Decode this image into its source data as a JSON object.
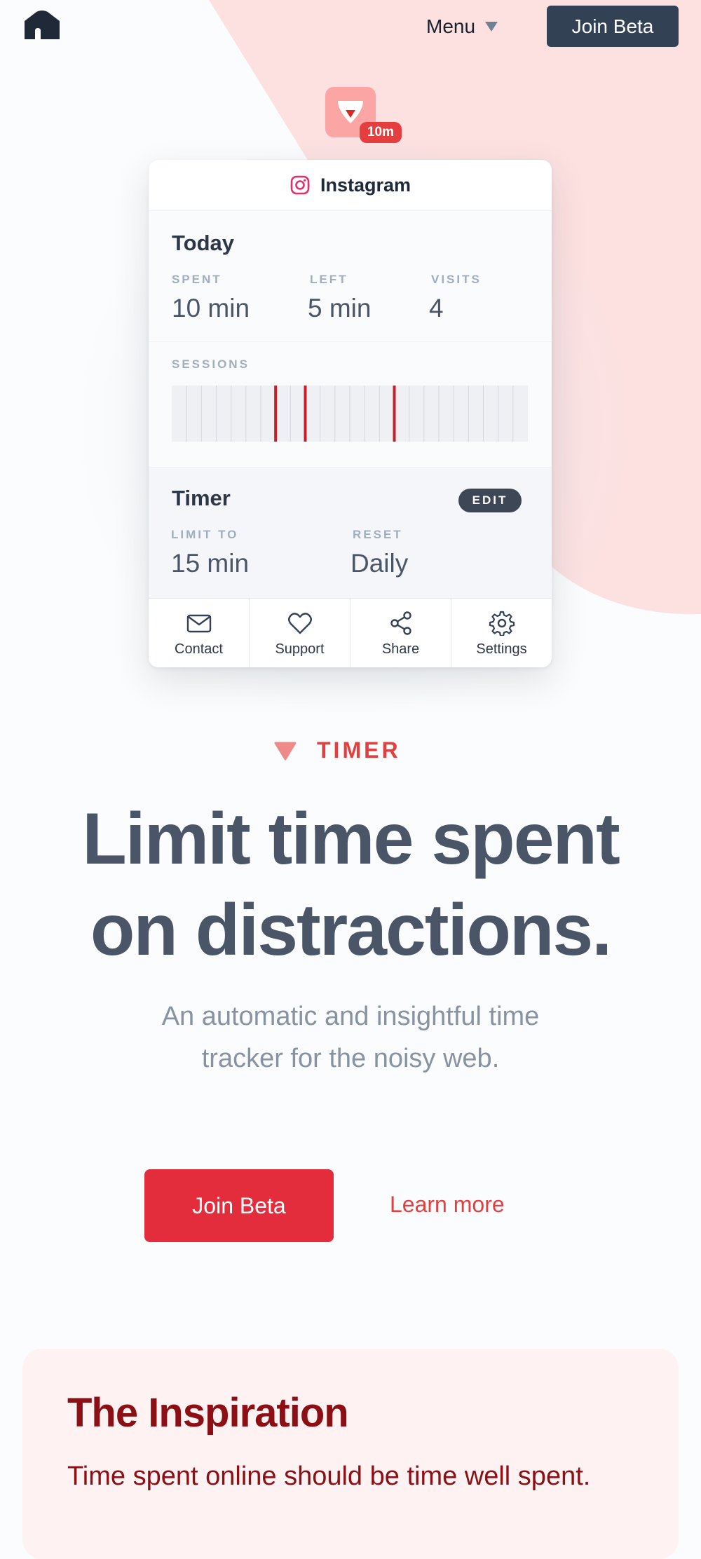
{
  "nav": {
    "menu_label": "Menu",
    "join_label": "Join Beta"
  },
  "app_icon": {
    "badge": "10m"
  },
  "card": {
    "app_name": "Instagram",
    "today": {
      "title": "Today",
      "stats": [
        {
          "label": "SPENT",
          "value": "10 min"
        },
        {
          "label": "LEFT",
          "value": "5 min"
        },
        {
          "label": "VISITS",
          "value": "4"
        }
      ]
    },
    "sessions": {
      "label": "SESSIONS",
      "segments": 24,
      "active_segments": [
        7,
        9,
        15
      ]
    },
    "timer": {
      "title": "Timer",
      "edit_label": "EDIT",
      "limit_label": "LIMIT TO",
      "limit_value": "15 min",
      "reset_label": "RESET",
      "reset_value": "Daily"
    },
    "tabs": [
      {
        "label": "Contact",
        "icon": "mail-icon"
      },
      {
        "label": "Support",
        "icon": "heart-icon"
      },
      {
        "label": "Share",
        "icon": "share-icon"
      },
      {
        "label": "Settings",
        "icon": "gear-icon"
      }
    ]
  },
  "hero": {
    "eyebrow": "TIMER",
    "headline_line1": "Limit time spent",
    "headline_line2": "on distractions.",
    "subhead_line1": "An automatic and insightful time",
    "subhead_line2": "tracker for the noisy web.",
    "primary_button": "Join Beta",
    "secondary_link": "Learn more"
  },
  "inspiration": {
    "title": "The Inspiration",
    "text": "Time spent online should be time well spent."
  },
  "colors": {
    "accent": "#e53e3e",
    "dark_button": "#334155",
    "pink_bg": "#fee2e2",
    "inspiration_text": "#8b0f14"
  }
}
